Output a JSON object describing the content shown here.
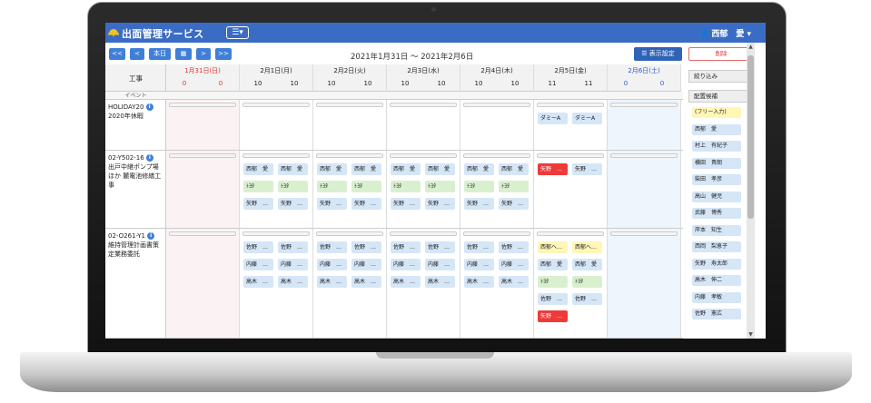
{
  "app": {
    "title": "出面管理サービス",
    "menu_icon": "menu-icon",
    "user_name": "西郁　愛"
  },
  "toolbar": {
    "prev_week": "<<",
    "prev_day": "<",
    "today": "本日",
    "calendar_icon": "calendar-icon",
    "next_day": ">",
    "next_week": ">>",
    "date_range": "2021年1月31日 〜 2021年2月6日",
    "settings_label": "表示設定",
    "delete_label": "削除"
  },
  "grid": {
    "corner_label": "工事",
    "event_label": "イベント",
    "days": [
      {
        "label": "1月31日(日)",
        "c1": "0",
        "c2": "0",
        "color": "#e03030"
      },
      {
        "label": "2月1日(月)",
        "c1": "10",
        "c2": "10",
        "color": "#222222"
      },
      {
        "label": "2月2日(火)",
        "c1": "10",
        "c2": "10",
        "color": "#222222"
      },
      {
        "label": "2月3日(水)",
        "c1": "10",
        "c2": "10",
        "color": "#222222"
      },
      {
        "label": "2月4日(木)",
        "c1": "10",
        "c2": "10",
        "color": "#222222"
      },
      {
        "label": "2月5日(金)",
        "c1": "11",
        "c2": "11",
        "color": "#222222"
      },
      {
        "label": "2月6日(土)",
        "c1": "0",
        "c2": "0",
        "color": "#2a55d0"
      }
    ],
    "projects": [
      {
        "code": "HOLIDAY20",
        "name": "2020年休暇",
        "chips": {
          "5": [
            [
              "ダミーA",
              "blue"
            ],
            [
              "ダミーA",
              "blue"
            ]
          ]
        }
      },
      {
        "code": "02-Y502-16",
        "name": "出戸中継ポンプ場ほか 麓電池修繕工事",
        "chips": {
          "1": [
            [
              "西郁　愛",
              "blue"
            ],
            [
              "西郁　愛",
              "blue"
            ],
            [
              "ﾄﾖﾀ",
              "green"
            ],
            [
              "ﾄﾖﾀ",
              "green"
            ],
            [
              "矢野　…",
              "blue"
            ],
            [
              "矢野　…",
              "blue"
            ]
          ],
          "2": [
            [
              "西郁　愛",
              "blue"
            ],
            [
              "西郁　愛",
              "blue"
            ],
            [
              "ﾄﾖﾀ",
              "green"
            ],
            [
              "ﾄﾖﾀ",
              "green"
            ],
            [
              "矢野　…",
              "blue"
            ],
            [
              "矢野　…",
              "blue"
            ]
          ],
          "3": [
            [
              "西郁　愛",
              "blue"
            ],
            [
              "西郁　愛",
              "blue"
            ],
            [
              "ﾄﾖﾀ",
              "green"
            ],
            [
              "ﾄﾖﾀ",
              "green"
            ],
            [
              "矢野　…",
              "blue"
            ],
            [
              "矢野　…",
              "blue"
            ]
          ],
          "4": [
            [
              "西郁　愛",
              "blue"
            ],
            [
              "西郁　愛",
              "blue"
            ],
            [
              "ﾄﾖﾀ",
              "green"
            ],
            [
              "ﾄﾖﾀ",
              "green"
            ],
            [
              "矢野　…",
              "blue"
            ],
            [
              "矢野　…",
              "blue"
            ]
          ],
          "5": [
            [
              "矢野　…",
              "red"
            ],
            [
              "矢野　…",
              "blue"
            ]
          ]
        }
      },
      {
        "code": "02-O261-Y1",
        "name": "維持管理計画書策定業務委託",
        "chips": {
          "1": [
            [
              "佐野　…",
              "blue"
            ],
            [
              "佐野　…",
              "blue"
            ],
            [
              "内藤　…",
              "blue"
            ],
            [
              "内藤　…",
              "blue"
            ],
            [
              "高木　…",
              "blue"
            ],
            [
              "高木　…",
              "blue"
            ]
          ],
          "2": [
            [
              "佐野　…",
              "blue"
            ],
            [
              "佐野　…",
              "blue"
            ],
            [
              "内藤　…",
              "blue"
            ],
            [
              "内藤　…",
              "blue"
            ],
            [
              "高木　…",
              "blue"
            ],
            [
              "高木　…",
              "blue"
            ]
          ],
          "3": [
            [
              "佐野　…",
              "blue"
            ],
            [
              "佐野　…",
              "blue"
            ],
            [
              "内藤　…",
              "blue"
            ],
            [
              "内藤　…",
              "blue"
            ],
            [
              "高木　…",
              "blue"
            ],
            [
              "高木　…",
              "blue"
            ]
          ],
          "4": [
            [
              "佐野　…",
              "blue"
            ],
            [
              "佐野　…",
              "blue"
            ],
            [
              "内藤　…",
              "blue"
            ],
            [
              "内藤　…",
              "blue"
            ],
            [
              "高木　…",
              "blue"
            ],
            [
              "高木　…",
              "blue"
            ]
          ],
          "5": [
            [
              "西郁へ…",
              "yellow"
            ],
            [
              "西郁へ…",
              "yellow"
            ],
            [
              "西郁　愛",
              "blue"
            ],
            [
              "西郁　愛",
              "blue"
            ],
            [
              "ﾄﾖﾀ",
              "green"
            ],
            [
              "ﾄﾖﾀ",
              "green"
            ],
            [
              "佐野　…",
              "blue"
            ],
            [
              "佐野　…",
              "blue"
            ],
            [
              "矢野　…",
              "red"
            ]
          ]
        }
      }
    ]
  },
  "sidepanel": {
    "filter_label": "絞り込み",
    "candidates_label": "配置候補",
    "candidates": [
      "(フリー入力)",
      "西郁　愛",
      "村上　有紀子",
      "横田　貴朗",
      "柴田　孝彦",
      "高山　健児",
      "武藤　博秀",
      "岸本　知生",
      "西岡　梨恵子",
      "矢野　寿太郎",
      "高木　伸二",
      "内藤　孝敏",
      "佐野　憲広"
    ]
  },
  "colors": {
    "header_blue": "#3b6cc5",
    "button_blue": "#3f7fd8",
    "sunday": "#e03030",
    "saturday": "#2a55d0",
    "chip_blue": "#d5e6f7",
    "chip_green": "#d9f0cf",
    "chip_red": "#ef3a3a",
    "chip_yellow": "#fff6b8"
  }
}
